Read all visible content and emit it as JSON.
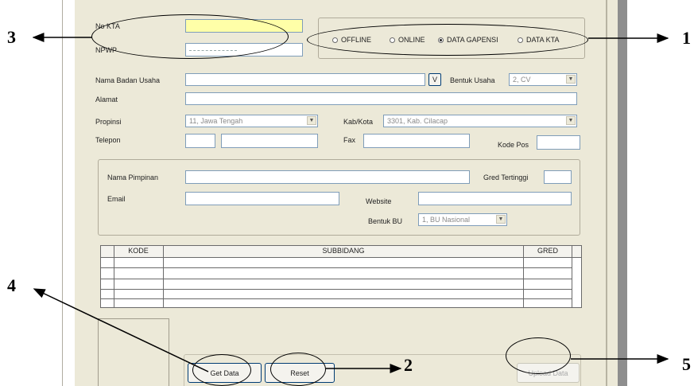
{
  "labels": {
    "no_kta": "No KTA",
    "npwp": "NPWP",
    "nama_badan_usaha": "Nama Badan Usaha",
    "alamat": "Alamat",
    "propinsi": "Propinsi",
    "telepon": "Telepon",
    "bentuk_usaha": "Bentuk Usaha",
    "kab_kota": "Kab/Kota",
    "fax": "Fax",
    "kode_pos": "Kode Pos",
    "nama_pimpinan": "Nama Pimpinan",
    "email": "Email",
    "gred_tertinggi": "Gred Tertinggi",
    "website": "Website",
    "bentuk_bu": "Bentuk BU"
  },
  "fields": {
    "bentuk_usaha": "2, CV",
    "propinsi": "11, Jawa Tengah",
    "kab_kota": "3301, Kab. Cilacap",
    "bentuk_bu": "1, BU Nasional",
    "search_button": "V"
  },
  "radios": [
    {
      "label": "OFFLINE",
      "selected": false
    },
    {
      "label": "ONLINE",
      "selected": false
    },
    {
      "label": "DATA GAPENSI",
      "selected": true
    },
    {
      "label": "DATA KTA",
      "selected": false
    }
  ],
  "table": {
    "columns": [
      "KODE",
      "SUBBIDANG",
      "GRED"
    ],
    "rows": 4
  },
  "buttons": {
    "get_data": "Get Data",
    "reset": "Reset",
    "upload_data": "Upload Data"
  },
  "callouts": [
    "1",
    "2",
    "3",
    "4",
    "5"
  ],
  "colors": {
    "window": "#ece9d8",
    "input_border": "#7f9db9",
    "highlight_input": "#ffffa8"
  }
}
